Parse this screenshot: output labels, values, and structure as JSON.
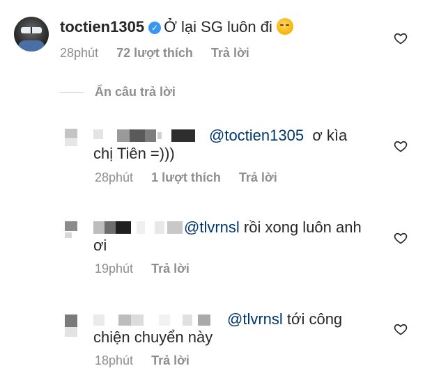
{
  "comments": {
    "main": {
      "username": "toctien1305",
      "text": "Ở lại SG luôn đi",
      "time": "28phút",
      "likes": "72 lượt thích",
      "reply": "Trả lời"
    },
    "hide_replies": "Ẩn câu trả lời",
    "replies": [
      {
        "mention": "@toctien1305",
        "text_line1": "ơ kìa",
        "text_line2": "chị Tiên =)))",
        "time": "28phút",
        "likes": "1 lượt thích",
        "reply": "Trả lời"
      },
      {
        "mention": "@tlvrnsl",
        "text_line1": "rồi xong luôn anh",
        "text_line2": "ơi",
        "time": "19phút",
        "reply": "Trả lời"
      },
      {
        "mention": "@tlvrnsl",
        "text_line1": "tới công",
        "text_line2": "chiện chuyển này",
        "time": "18phút",
        "reply": "Trả lời"
      }
    ]
  },
  "icons": {
    "like": "heart-outline-icon",
    "verified": "verified-badge-icon",
    "emoji": "flushed-face-emoji"
  },
  "colors": {
    "text": "#262626",
    "muted": "#8e8e8e",
    "mention": "#00376b",
    "verified": "#3897f0"
  }
}
